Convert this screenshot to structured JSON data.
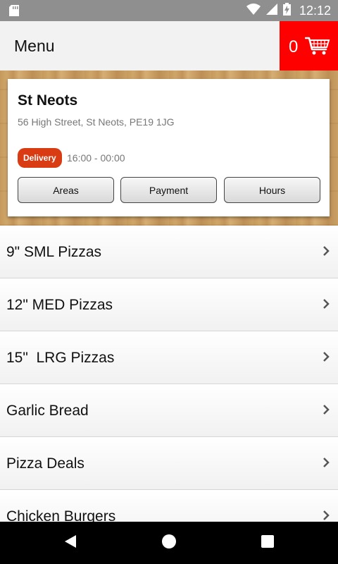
{
  "status_bar": {
    "time": "12:12"
  },
  "header": {
    "title": "Menu",
    "cart_count": "0"
  },
  "store": {
    "name": "St Neots",
    "address": "56 High Street, St Neots, PE19 1JG",
    "badge": "Delivery",
    "hours": "16:00 - 00:00",
    "buttons": {
      "areas": "Areas",
      "payment": "Payment",
      "hours": "Hours"
    }
  },
  "menu": {
    "items": [
      {
        "label": "9\" SML Pizzas"
      },
      {
        "label": "12\" MED Pizzas"
      },
      {
        "label": "15\"  LRG Pizzas"
      },
      {
        "label": "Garlic Bread"
      },
      {
        "label": "Pizza Deals"
      },
      {
        "label": "Chicken Burgers"
      }
    ]
  },
  "colors": {
    "accent": "#ff0000",
    "badge": "#d93b12",
    "status_bar": "#8f8f8f"
  },
  "icons": [
    "sd-card-icon",
    "wifi-icon",
    "signal-icon",
    "battery-icon",
    "cart-icon",
    "chevron-right-icon",
    "back-icon",
    "home-icon",
    "recents-icon"
  ]
}
